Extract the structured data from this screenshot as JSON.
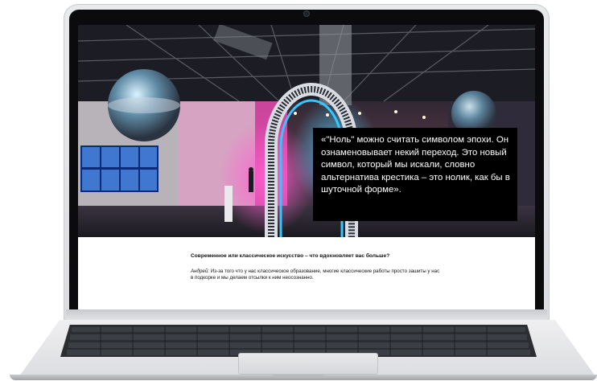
{
  "quote": {
    "text": "«\"Ноль\" можно считать символом эпохи. Он ознаменовывает некий переход. Это новый символ, который мы искали, словно альтернатива крестика – это нолик, как бы в шуточной форме»."
  },
  "article": {
    "heading": "Современное или классическое искусство – что вдохновляет вас больше?",
    "speaker": "Андрей:",
    "body": " Из-за того что у нас классическое образование, многие классические работы просто зашиты у нас в подкорке и мы делаем отсылки к ним неосознанно."
  },
  "colors": {
    "quote_bg": "#000000",
    "quote_text": "#ffffff",
    "screen_bg": "#ffffff",
    "laptop_body": "#e3e4e6"
  },
  "icons": [
    "camera-icon"
  ]
}
